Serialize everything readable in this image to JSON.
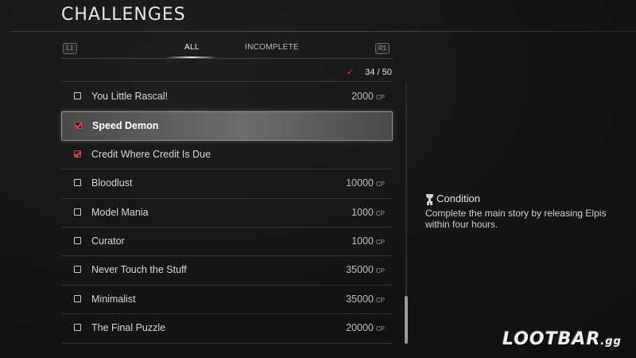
{
  "header": {
    "title": "CHALLENGES"
  },
  "tabs": {
    "left_bumper": "L1",
    "right_bumper": "R1",
    "items": [
      {
        "label": "ALL",
        "active": true
      },
      {
        "label": "INCOMPLETE",
        "active": false
      }
    ]
  },
  "progress": {
    "check_icon": "check-icon",
    "text": "34 / 50",
    "completed": 34,
    "total": 50
  },
  "challenges": [
    {
      "name": "You Little Rascal!",
      "points": "2000",
      "unit": "CP",
      "completed": false,
      "selected": false
    },
    {
      "name": "Speed Demon",
      "points": "",
      "unit": "",
      "completed": true,
      "selected": true
    },
    {
      "name": "Credit Where Credit Is Due",
      "points": "",
      "unit": "",
      "completed": true,
      "selected": false
    },
    {
      "name": "Bloodlust",
      "points": "10000",
      "unit": "CP",
      "completed": false,
      "selected": false
    },
    {
      "name": "Model Mania",
      "points": "1000",
      "unit": "CP",
      "completed": false,
      "selected": false
    },
    {
      "name": "Curator",
      "points": "1000",
      "unit": "CP",
      "completed": false,
      "selected": false
    },
    {
      "name": "Never Touch the Stuff",
      "points": "35000",
      "unit": "CP",
      "completed": false,
      "selected": false
    },
    {
      "name": "Minimalist",
      "points": "35000",
      "unit": "CP",
      "completed": false,
      "selected": false
    },
    {
      "name": "The Final Puzzle",
      "points": "20000",
      "unit": "CP",
      "completed": false,
      "selected": false
    }
  ],
  "detail": {
    "icon": "trophy-icon",
    "heading": "Condition",
    "description": "Complete the main story by releasing Elpis within four hours."
  },
  "watermark": {
    "main": "LOOTBAR",
    "suffix": ".gg"
  },
  "colors": {
    "accent_check": "#c8454a",
    "background": "#141414",
    "text": "#d4d4d4"
  }
}
